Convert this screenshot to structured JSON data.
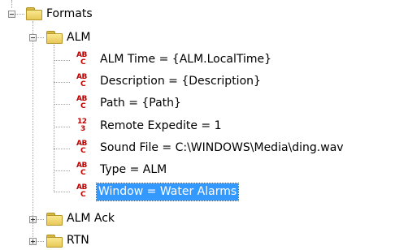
{
  "tree": {
    "root": {
      "label": "Formats",
      "icon": "folder-open-icon",
      "expanded": true,
      "children": [
        {
          "label": "ALM",
          "icon": "folder-open-icon",
          "expanded": true,
          "properties": [
            {
              "label": "ALM Time = {ALM.LocalTime}",
              "icon": "string-type-icon",
              "type_glyph": {
                "top": "AB",
                "bottom": "C"
              }
            },
            {
              "label": "Description = {Description}",
              "icon": "string-type-icon",
              "type_glyph": {
                "top": "AB",
                "bottom": "C"
              }
            },
            {
              "label": "Path = {Path}",
              "icon": "string-type-icon",
              "type_glyph": {
                "top": "AB",
                "bottom": "C"
              }
            },
            {
              "label": "Remote Expedite = 1",
              "icon": "number-type-icon",
              "type_glyph": {
                "top": "12",
                "bottom": "3"
              }
            },
            {
              "label": "Sound File = C:\\WINDOWS\\Media\\ding.wav",
              "icon": "string-type-icon",
              "type_glyph": {
                "top": "AB",
                "bottom": "C"
              }
            },
            {
              "label": "Type = ALM",
              "icon": "string-type-icon",
              "type_glyph": {
                "top": "AB",
                "bottom": "C"
              }
            },
            {
              "label": "Window = Water Alarms",
              "icon": "string-type-icon",
              "type_glyph": {
                "top": "AB",
                "bottom": "C"
              },
              "selected": true
            }
          ]
        },
        {
          "label": "ALM Ack",
          "icon": "folder-closed-icon",
          "expanded": false
        },
        {
          "label": "RTN",
          "icon": "folder-closed-icon",
          "expanded": false
        }
      ]
    },
    "colors": {
      "selection_background": "#3399ff",
      "selection_text": "#ffffff",
      "type_icon": "#c00000",
      "folder_fill": "#f2d56e",
      "connector_lines": "#a0a0a0"
    }
  }
}
